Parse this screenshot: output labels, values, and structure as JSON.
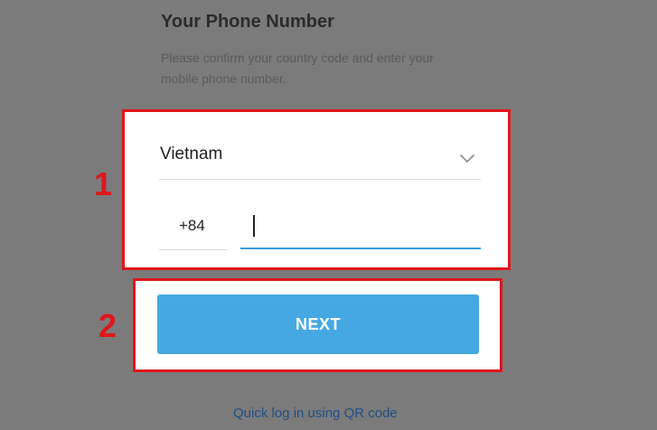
{
  "header": {
    "title": "Your Phone Number",
    "subtitle": "Please confirm your country code and enter your mobile phone number."
  },
  "form": {
    "country": "Vietnam",
    "country_code": "+84",
    "phone_value": "",
    "phone_placeholder": ""
  },
  "actions": {
    "next_label": "NEXT",
    "qr_link_label": "Quick log in using QR code"
  },
  "annotations": {
    "step_1": "1",
    "step_2": "2"
  },
  "colors": {
    "accent": "#45a8e2",
    "input_underline": "#3b9ad9",
    "highlight": "#e0151b",
    "link": "#1f4f86"
  },
  "icons": {
    "country_dropdown": "chevron-down-icon"
  }
}
